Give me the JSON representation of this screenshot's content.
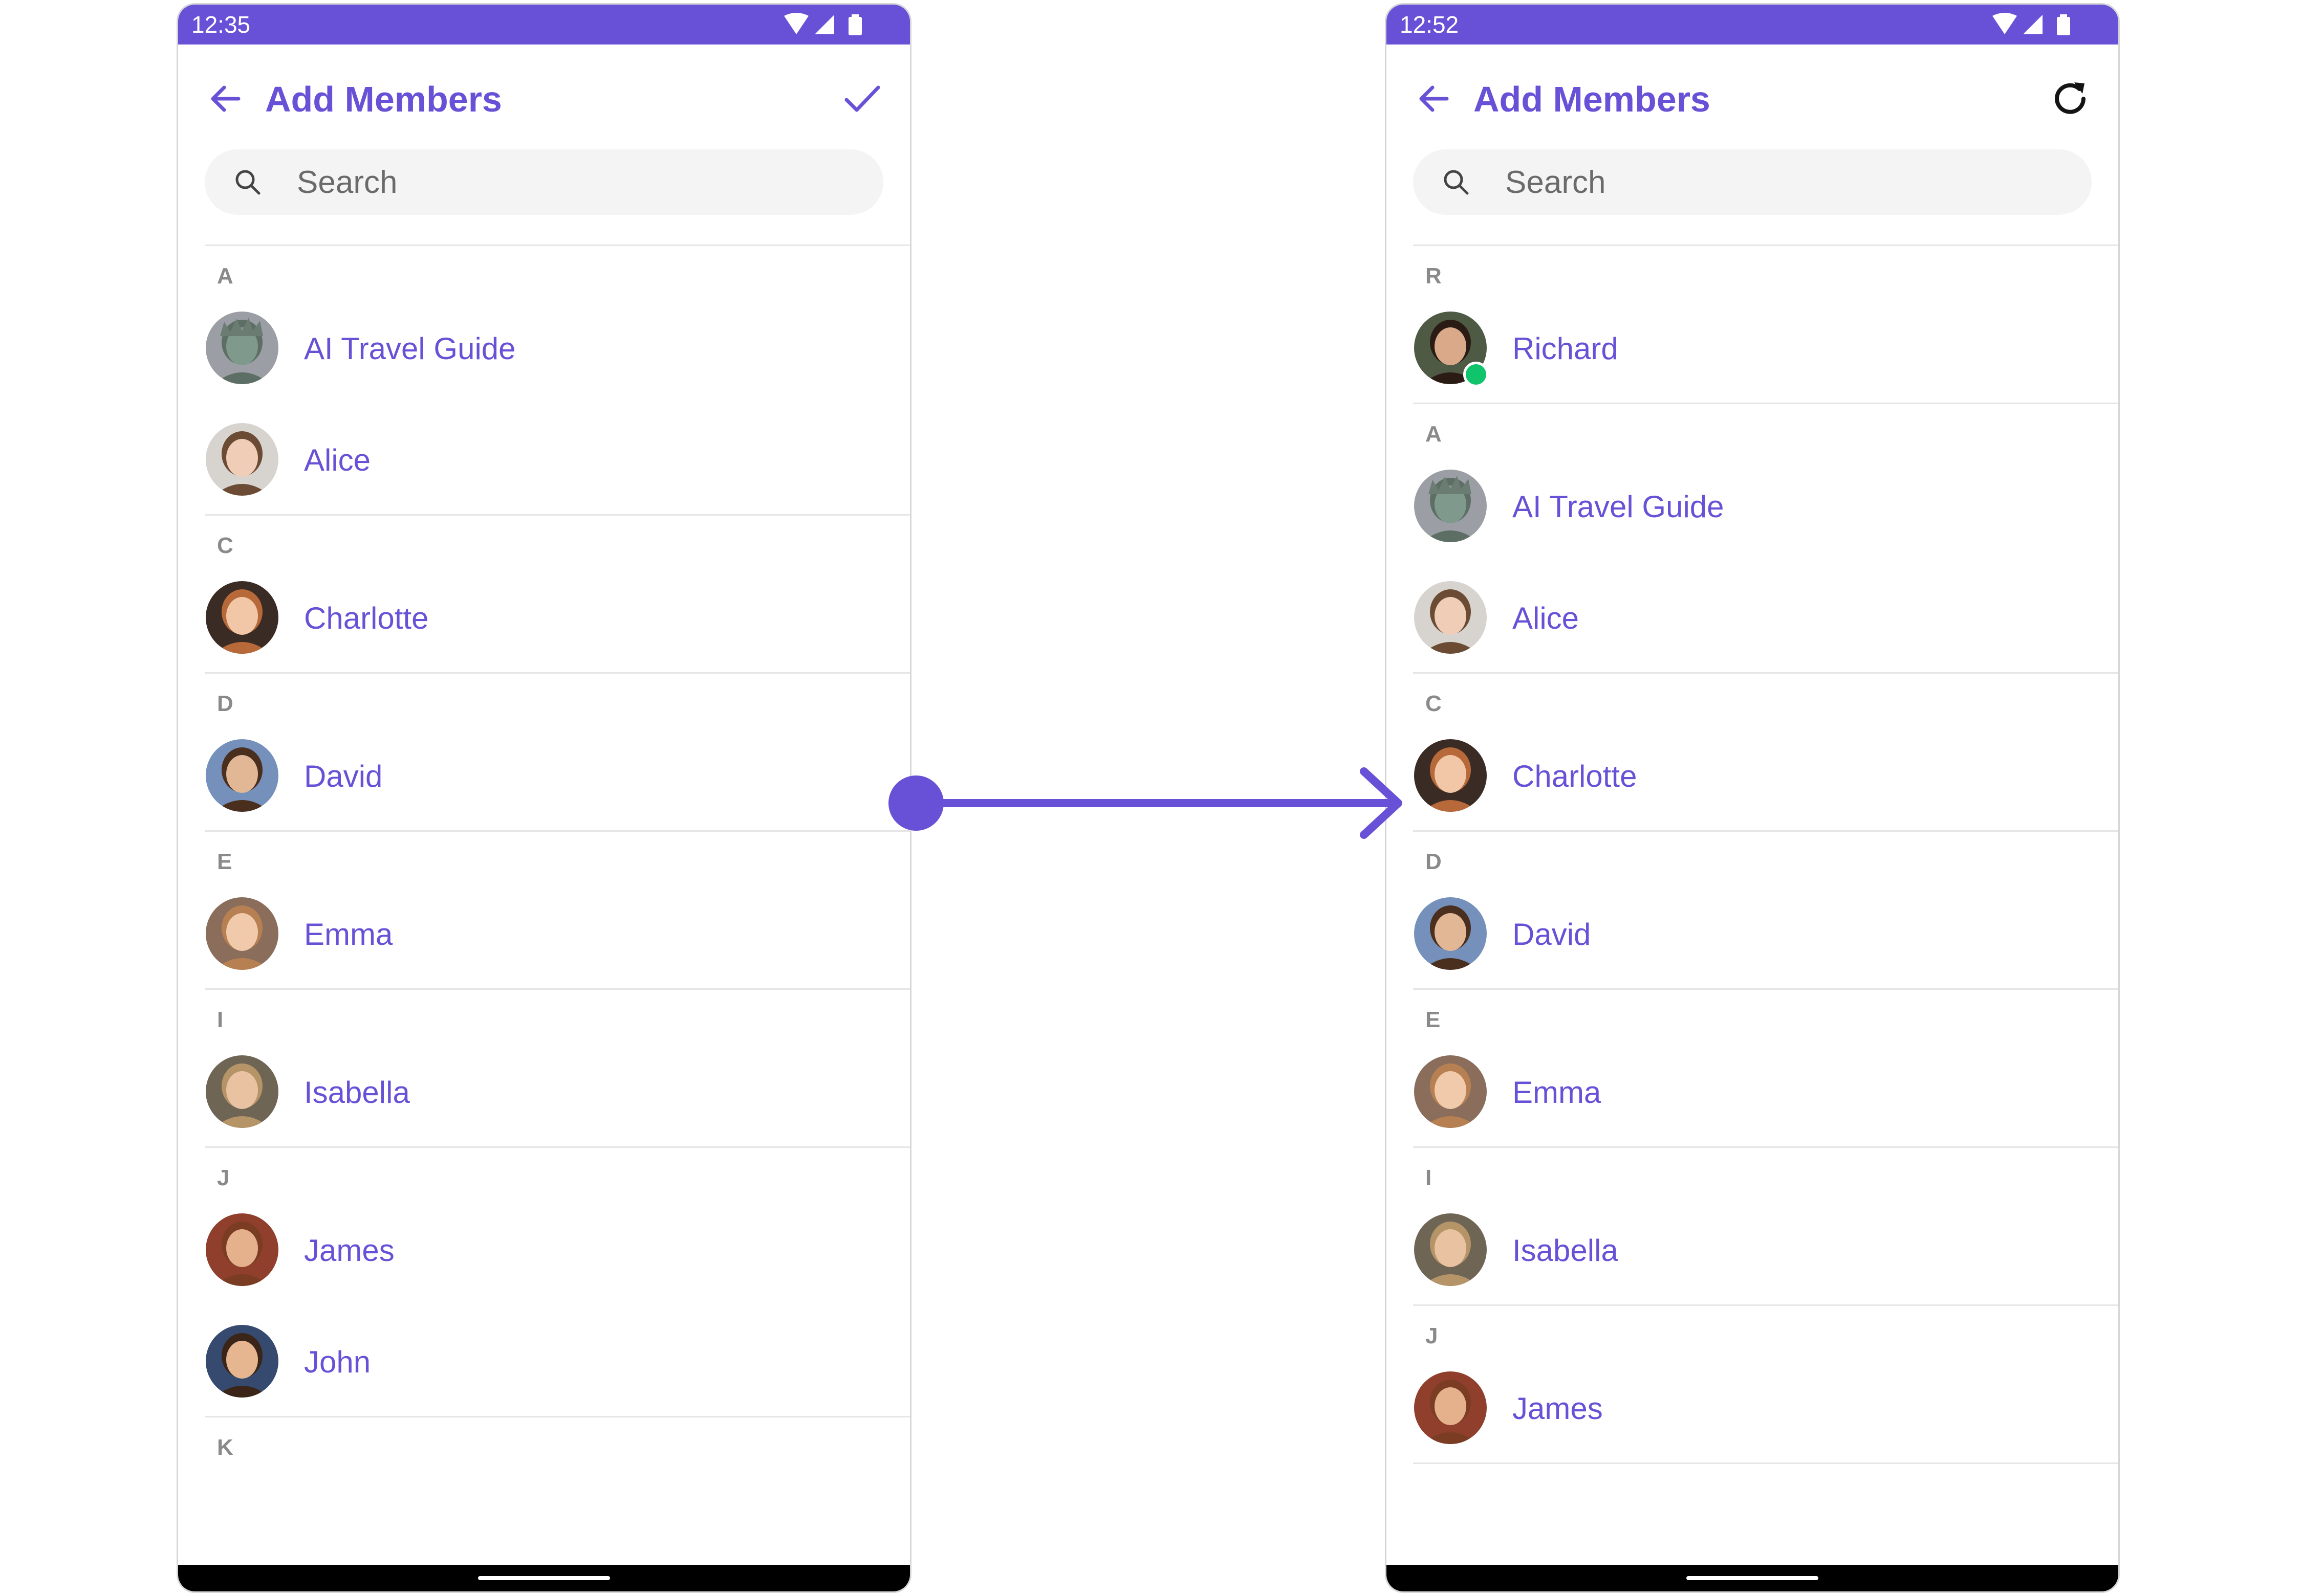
{
  "colors": {
    "accent": "#6851d6",
    "status_bar": "#6851d6",
    "name_text": "#6851d6",
    "section_header": "#8a8a8a",
    "search_bg": "#f4f4f4",
    "divider": "#e6e6e6",
    "presence_online": "#10c46b",
    "nav_bar": "#000000"
  },
  "screens": [
    {
      "status_time": "12:35",
      "title": "Add Members",
      "back_icon": "arrow-left-icon",
      "action_icon": "check-icon",
      "search_placeholder": "Search",
      "sections": [
        {
          "letter": "A",
          "members": [
            {
              "name": "AI Travel Guide",
              "avatar": "ai-travel-guide-avatar",
              "online": false
            },
            {
              "name": "Alice",
              "avatar": "alice-avatar",
              "online": false
            }
          ]
        },
        {
          "letter": "C",
          "members": [
            {
              "name": "Charlotte",
              "avatar": "charlotte-avatar",
              "online": false
            }
          ]
        },
        {
          "letter": "D",
          "members": [
            {
              "name": "David",
              "avatar": "david-avatar",
              "online": false
            }
          ]
        },
        {
          "letter": "E",
          "members": [
            {
              "name": "Emma",
              "avatar": "emma-avatar",
              "online": false
            }
          ]
        },
        {
          "letter": "I",
          "members": [
            {
              "name": "Isabella",
              "avatar": "isabella-avatar",
              "online": false
            }
          ]
        },
        {
          "letter": "J",
          "members": [
            {
              "name": "James",
              "avatar": "james-avatar",
              "online": false
            },
            {
              "name": "John",
              "avatar": "john-avatar",
              "online": false
            }
          ]
        },
        {
          "letter": "K",
          "members": []
        }
      ]
    },
    {
      "status_time": "12:52",
      "title": "Add Members",
      "back_icon": "arrow-left-icon",
      "action_icon": "refresh-icon",
      "search_placeholder": "Search",
      "sections": [
        {
          "letter": "R",
          "members": [
            {
              "name": "Richard",
              "avatar": "richard-avatar",
              "online": true
            }
          ]
        },
        {
          "letter": "A",
          "members": [
            {
              "name": "AI Travel Guide",
              "avatar": "ai-travel-guide-avatar",
              "online": false
            },
            {
              "name": "Alice",
              "avatar": "alice-avatar",
              "online": false
            }
          ]
        },
        {
          "letter": "C",
          "members": [
            {
              "name": "Charlotte",
              "avatar": "charlotte-avatar",
              "online": false
            }
          ]
        },
        {
          "letter": "D",
          "members": [
            {
              "name": "David",
              "avatar": "david-avatar",
              "online": false
            }
          ]
        },
        {
          "letter": "E",
          "members": [
            {
              "name": "Emma",
              "avatar": "emma-avatar",
              "online": false
            }
          ]
        },
        {
          "letter": "I",
          "members": [
            {
              "name": "Isabella",
              "avatar": "isabella-avatar",
              "online": false
            }
          ]
        },
        {
          "letter": "J",
          "members": [
            {
              "name": "James",
              "avatar": "james-avatar",
              "online": false
            }
          ]
        }
      ]
    }
  ]
}
